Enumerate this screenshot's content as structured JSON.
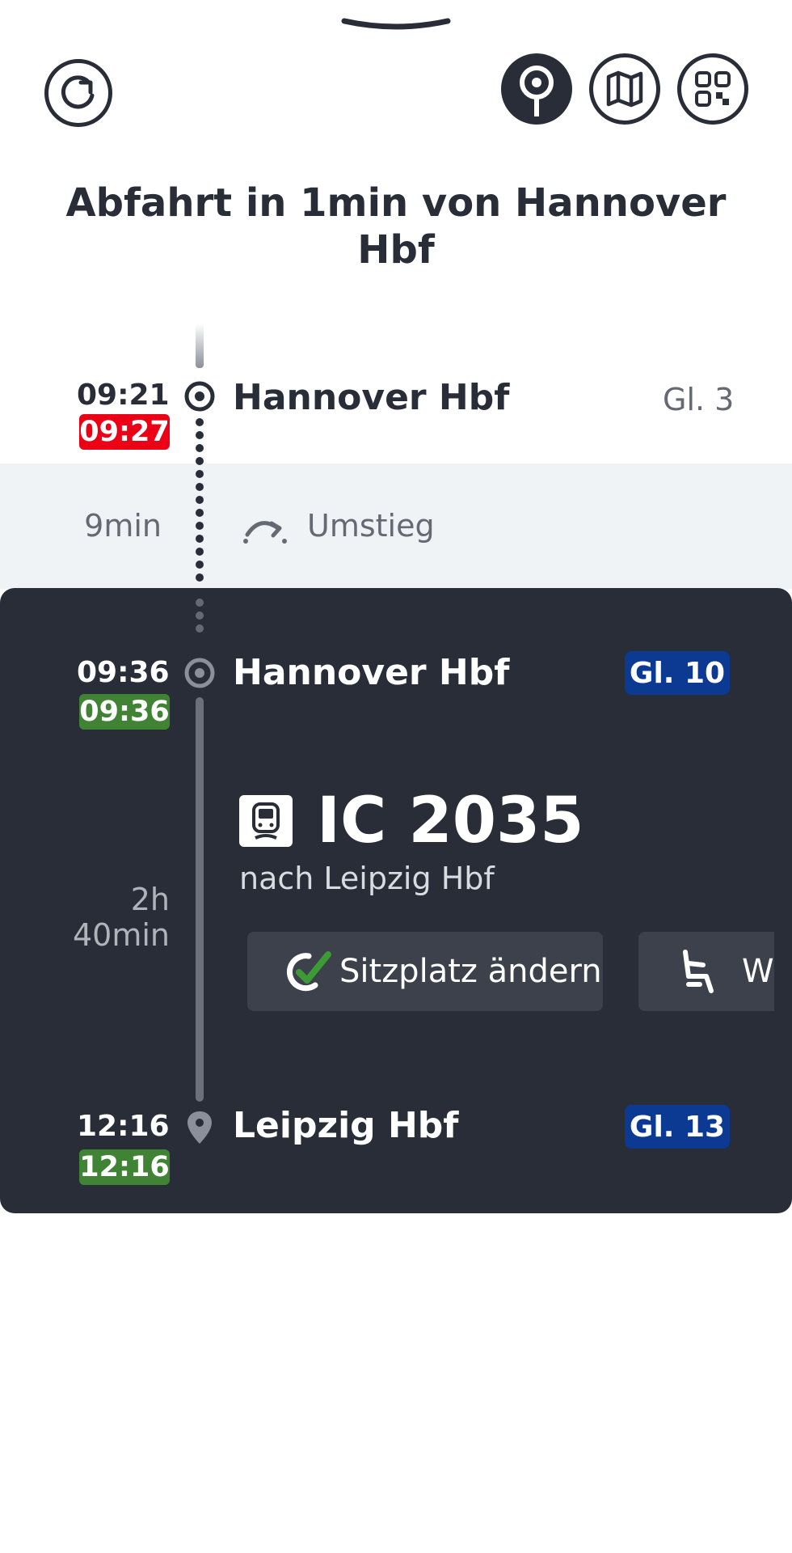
{
  "header": {
    "refresh_icon": "refresh-icon",
    "buttons": [
      {
        "icon": "location-pin-icon",
        "active": true
      },
      {
        "icon": "map-icon",
        "active": false
      },
      {
        "icon": "qr-code-icon",
        "active": false
      }
    ]
  },
  "title": "Abfahrt in 1min von Hannover Hbf",
  "stops": {
    "origin": {
      "planned": "09:21",
      "actual": "09:27",
      "station": "Hannover Hbf",
      "platform": "Gl. 3",
      "status_color": "#ec0016"
    },
    "transfer": {
      "duration": "9min",
      "label": "Umstieg"
    },
    "departure": {
      "planned": "09:36",
      "actual": "09:36",
      "station": "Hannover Hbf",
      "platform": "Gl. 10",
      "status_color": "#408335"
    },
    "arrival": {
      "planned": "12:16",
      "actual": "12:16",
      "station": "Leipzig Hbf",
      "platform": "Gl. 13",
      "status_color": "#408335"
    }
  },
  "train": {
    "name": "IC 2035",
    "destination": "nach Leipzig Hbf",
    "duration": "2h 40min",
    "icon": "train-icon"
  },
  "actions": [
    {
      "label": "Sitzplatz ändern",
      "icon": "seat-check-icon"
    },
    {
      "label": "W",
      "icon": "seat-icon"
    }
  ],
  "colors": {
    "dark": "#282d37",
    "platform_blue": "#0c3992",
    "delay_red": "#ec0016",
    "ontime_green": "#408335"
  }
}
